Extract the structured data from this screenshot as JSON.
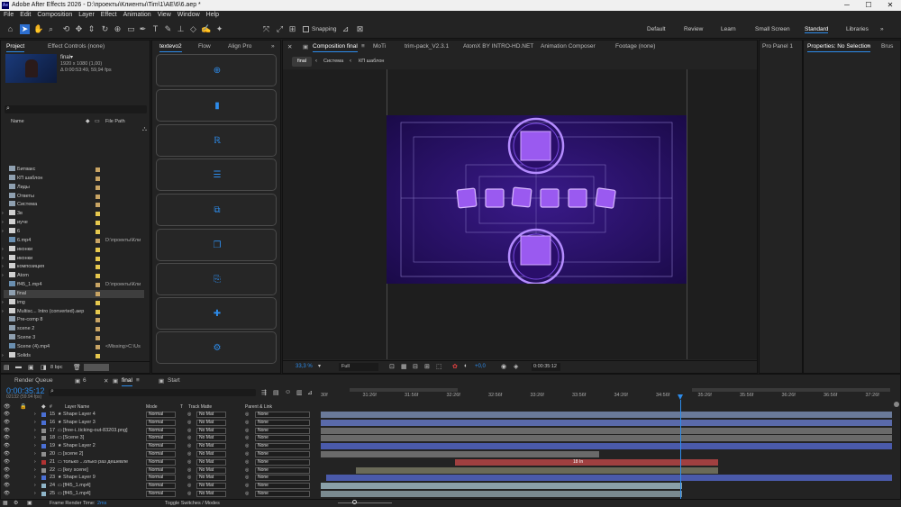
{
  "window": {
    "title": "Adobe After Effects 2026 - D:\\проекты\\Клиенты\\Tim\\1\\AE\\6\\6.aep *",
    "app_badge": "Ae",
    "minimize": "─",
    "maximize": "☐",
    "close": "✕"
  },
  "menu": [
    "File",
    "Edit",
    "Composition",
    "Layer",
    "Effect",
    "Animation",
    "View",
    "Window",
    "Help"
  ],
  "toolbar": {
    "snapping_label": "Snapping",
    "snapping_checked": false
  },
  "workspaces": [
    "Default",
    "Review",
    "Learn",
    "Small Screen",
    "Standard",
    "Libraries"
  ],
  "workspace_active": "Standard",
  "project_panel": {
    "tabs": [
      "Project",
      "Effect Controls (none)"
    ],
    "preview": {
      "name": "final▾",
      "resolution": "1920 x 1080 (1,00)",
      "duration": "Δ 0:00:53:49, 59,94 fps"
    },
    "search_placeholder": "",
    "columns": {
      "name": "Name",
      "file_path": "File Path"
    },
    "items": [
      {
        "name": "Битвакс",
        "type": "comp",
        "label": "#c8a464",
        "path": ""
      },
      {
        "name": "КП шаблон",
        "type": "comp",
        "label": "#c8a464",
        "path": ""
      },
      {
        "name": "Лиды",
        "type": "comp",
        "label": "#c8a464",
        "path": ""
      },
      {
        "name": "Ответы",
        "type": "comp",
        "label": "#c8a464",
        "path": ""
      },
      {
        "name": "Система",
        "type": "comp",
        "label": "#c8a464",
        "path": ""
      },
      {
        "name": "3в",
        "type": "folder",
        "label": "#e6c84e",
        "path": ""
      },
      {
        "name": "иуче",
        "type": "folder",
        "label": "#e6c84e",
        "path": ""
      },
      {
        "name": "6",
        "type": "folder",
        "label": "#e6c84e",
        "path": ""
      },
      {
        "name": "6.mp4",
        "type": "footage",
        "label": "#c8a464",
        "path": "D:\\проекты\\Кли"
      },
      {
        "name": "иконки",
        "type": "folder",
        "label": "#e6c84e",
        "path": ""
      },
      {
        "name": "иконки",
        "type": "folder",
        "label": "#e6c84e",
        "path": ""
      },
      {
        "name": "композиция",
        "type": "folder",
        "label": "#e6c84e",
        "path": ""
      },
      {
        "name": "Atom",
        "type": "folder",
        "label": "#e6c84e",
        "path": ""
      },
      {
        "name": "ff45_1.mp4",
        "type": "footage",
        "label": "#c8a464",
        "path": "D:\\проекты\\Кли"
      },
      {
        "name": "final",
        "type": "comp",
        "label": "#c8a464",
        "path": "",
        "selected": true
      },
      {
        "name": "img",
        "type": "folder",
        "label": "#e6c84e",
        "path": ""
      },
      {
        "name": "Multisc... Intro (converted).aep",
        "type": "folder",
        "label": "#e6c84e",
        "path": ""
      },
      {
        "name": "Pre-comp 8",
        "type": "comp",
        "label": "#c8a464",
        "path": ""
      },
      {
        "name": "scene 2",
        "type": "comp",
        "label": "#c8a464",
        "path": ""
      },
      {
        "name": "Scene 3",
        "type": "comp",
        "label": "#c8a464",
        "path": ""
      },
      {
        "name": "Scene (4).mp4",
        "type": "footage",
        "label": "#c8a464",
        "path": "<Missing>C:\\Us"
      },
      {
        "name": "Solids",
        "type": "folder",
        "label": "#e6c84e",
        "path": ""
      }
    ],
    "bpc": "8 bpc"
  },
  "plugin_panel": {
    "tabs": [
      "textevo2",
      "Flow",
      "Align Pro"
    ]
  },
  "comp_panel": {
    "tabs": [
      "Composition final",
      "MoTi",
      "trim-pack_V2.3.1",
      "AtomX BY INTRO-HD.NET",
      "Animation Composer",
      "Footage (none)"
    ],
    "breadcrumbs": [
      "final",
      "Система",
      "КП шаблон"
    ],
    "zoom": "33,3 %",
    "resolution": "Full",
    "exposure": "+0,0",
    "timecode": "0:00:35:12"
  },
  "right_panels": {
    "tabs": [
      "Pro Panel 1",
      "Properties: No Selection",
      "Brus"
    ]
  },
  "timeline": {
    "tabs": [
      "Render Queue",
      "6",
      "final",
      "Start"
    ],
    "current_time": "0:00:35:12",
    "frame_info": "02132 (59.94 fps)",
    "col_headers": {
      "layer_name": "Layer Name",
      "mode": "Mode",
      "t": "T",
      "track_matte": "Track Matte",
      "parent": "Parent & Link"
    },
    "ticks": [
      "30f",
      "31:26f",
      "31:56f",
      "32:26f",
      "32:56f",
      "33:26f",
      "33:56f",
      "34:26f",
      "34:56f",
      "35:26f",
      "35:56f",
      "36:26f",
      "36:56f",
      "37:26f"
    ],
    "layers": [
      {
        "num": "15",
        "name": "Shape Layer 4",
        "color": "#4a6fd4",
        "star": true
      },
      {
        "num": "16",
        "name": "Shape Layer 3",
        "color": "#4a6fd4",
        "star": true
      },
      {
        "num": "17",
        "name": "[free-i..ticking-out-83203.png]",
        "color": "#8f8f8f",
        "star": false
      },
      {
        "num": "18",
        "name": "[Scene 3]",
        "color": "#8f8f8f",
        "star": false
      },
      {
        "num": "19",
        "name": "Shape Layer 2",
        "color": "#4a6fd4",
        "star": true
      },
      {
        "num": "20",
        "name": "[scene 2]",
        "color": "#8f8f8f",
        "star": false
      },
      {
        "num": "21",
        "name": "только ...олько раз дешевле",
        "color": "#b03232",
        "star": false
      },
      {
        "num": "22",
        "name": "[key scene]",
        "color": "#8f8f8f",
        "star": false
      },
      {
        "num": "23",
        "name": "Shape Layer 9",
        "color": "#4a6fd4",
        "star": true
      },
      {
        "num": "24",
        "name": "[ff45_1.mp4]",
        "color": "#8fb5c8",
        "star": false
      },
      {
        "num": "25",
        "name": "[ff45_1.mp4]",
        "color": "#8fb5c8",
        "star": false
      }
    ],
    "mode_value": "Normal",
    "matte_value": "No Mat",
    "parent_value": "None",
    "bar_label": "18 In",
    "footer": {
      "render_time_label": "Frame Render Time:",
      "render_time": "2ms",
      "toggle": "Toggle Switches / Modes"
    }
  }
}
